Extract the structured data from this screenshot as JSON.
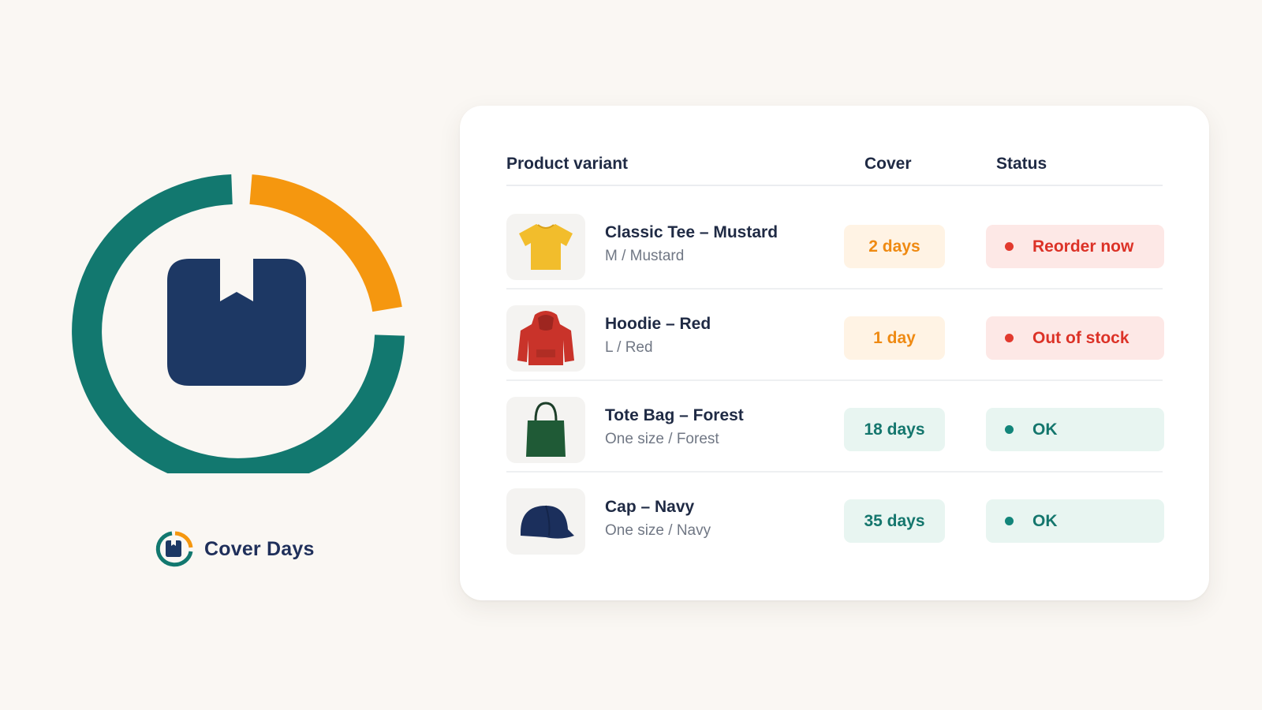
{
  "brand": {
    "name": "Cover Days",
    "colors": {
      "teal": "#12786f",
      "orange": "#f5970f",
      "navy": "#1d3864"
    }
  },
  "table": {
    "headers": {
      "product": "Product variant",
      "cover": "Cover",
      "status": "Status"
    },
    "rows": [
      {
        "name": "Classic Tee – Mustard",
        "variant": "M / Mustard",
        "icon": "t-shirt-icon",
        "cover": "2 days",
        "status": "Reorder now",
        "tone": "warn"
      },
      {
        "name": "Hoodie – Red",
        "variant": "L / Red",
        "icon": "hoodie-icon",
        "cover": "1 day",
        "status": "Out of stock",
        "tone": "warn"
      },
      {
        "name": "Tote Bag – Forest",
        "variant": "One size / Forest",
        "icon": "tote-bag-icon",
        "cover": "18 days",
        "status": "OK",
        "tone": "ok"
      },
      {
        "name": "Cap – Navy",
        "variant": "One size / Navy",
        "icon": "cap-icon",
        "cover": "35 days",
        "status": "OK",
        "tone": "ok"
      }
    ]
  },
  "tones": {
    "warn": {
      "cover_bg": "#fff3e4",
      "cover_fg": "#ef8a12",
      "status_bg": "#fde8e6",
      "status_fg": "#dc3227",
      "dot": "#e23a2e"
    },
    "ok": {
      "cover_bg": "#e8f5f1",
      "cover_fg": "#14766d",
      "status_bg": "#e8f5f1",
      "status_fg": "#14766d",
      "dot": "#12857a"
    }
  }
}
